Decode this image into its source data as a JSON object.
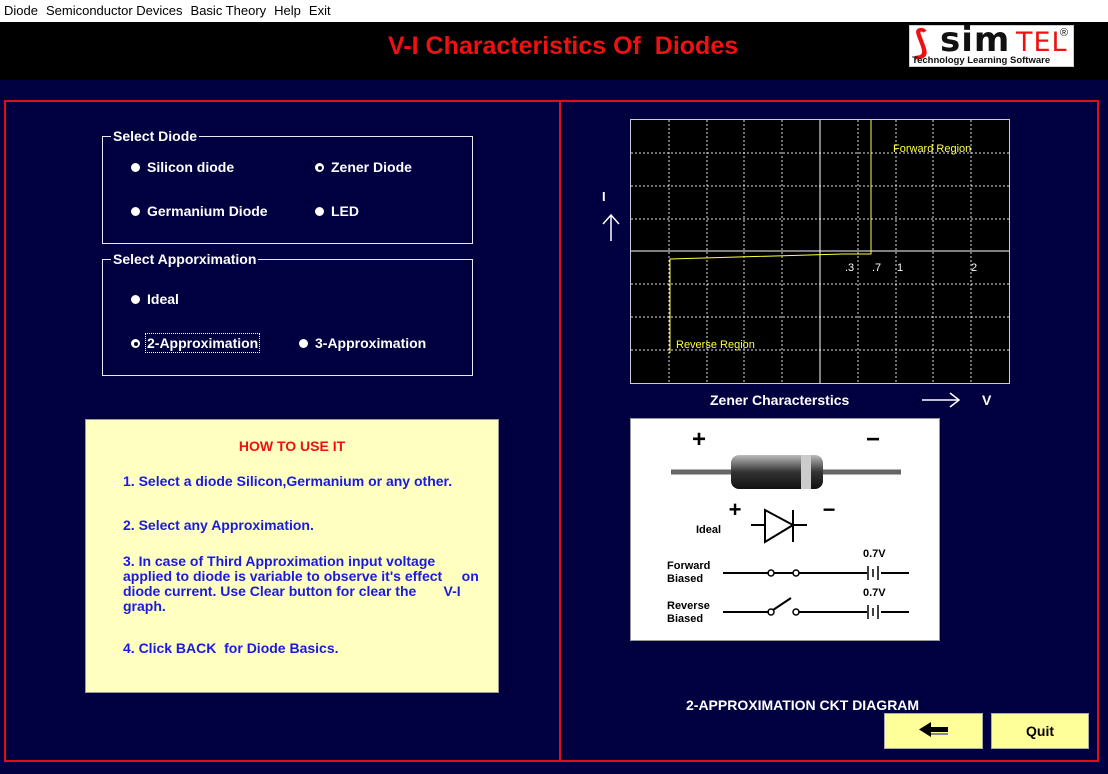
{
  "menu": [
    "Diode",
    "Semiconductor Devices",
    "Basic Theory",
    "Help",
    "Exit"
  ],
  "header": {
    "title": "V-I Characteristics Of  Diodes",
    "logo": {
      "brand_a": "sim",
      "brand_b": "TEL",
      "reg": "®",
      "tagline": "Technology Learning  Software"
    }
  },
  "select_diode": {
    "legend": "Select Diode",
    "options": [
      "Silicon diode",
      "Zener Diode",
      "Germanium Diode",
      "LED"
    ],
    "selected": "Zener Diode"
  },
  "select_approx": {
    "legend": "Select Apporximation",
    "options": [
      "Ideal",
      "2-Approximation",
      "3-Approximation"
    ],
    "selected": "2-Approximation"
  },
  "how_to": {
    "title": "HOW TO USE IT",
    "steps": [
      "1. Select a diode Silicon,Germanium or any other.",
      "2. Select any Approximation.",
      "3. In case of Third Approximation input voltage\napplied to diode is variable to observe it's effect     on\ndiode current. Use Clear button for clear the       V-I\ngraph.",
      "4. Click BACK  for Diode Basics."
    ]
  },
  "graph": {
    "y_axis_label": "I",
    "x_axis_label": "V",
    "caption": "Zener Characterstics",
    "forward_label": "Forward Region",
    "reverse_label": "Reverse Region",
    "ticks": [
      ".3",
      ".7",
      "1",
      "2"
    ]
  },
  "diagram": {
    "plus": "+",
    "minus": "−",
    "ideal_label": "Ideal",
    "forward_label": [
      "Forward",
      "Biased"
    ],
    "reverse_label": [
      "Reverse",
      "Biased"
    ],
    "voltage": "0.7V"
  },
  "circuit_caption": "2-APPROXIMATION CKT DIAGRAM",
  "buttons": {
    "quit": "Quit"
  },
  "colors": {
    "background": "#000040",
    "title": "#ee1111",
    "panel_border": "#e01010",
    "trace": "#ffff40",
    "instructions": "#1a1ae0",
    "button": "#ffff99"
  }
}
